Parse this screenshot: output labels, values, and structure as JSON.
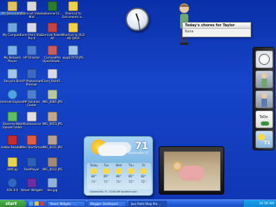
{
  "desktop_icons": [
    {
      "label": "My Documents",
      "color": "#e6c35a"
    },
    {
      "label": "Comcast Video Mail",
      "color": "#d9d9d9"
    },
    {
      "label": "kwbanner12....",
      "color": "#2a7c2a"
    },
    {
      "label": "Shortcut to Documents a...",
      "color": "#f2cf4b"
    },
    {
      "label": "My Computer",
      "color": "#6fa4e0"
    },
    {
      "label": "Corel Paint Shop Pro X",
      "color": "#d8d8e8"
    },
    {
      "label": "Carnival Rewind All",
      "color": "#c94040"
    },
    {
      "label": "Shortcut to OLD HD DATA",
      "color": "#f2cf4b"
    },
    {
      "label": "My Network Places",
      "color": "#7ab0e8"
    },
    {
      "label": "HP Director",
      "color": "#4d7fd0"
    },
    {
      "label": "CarnivalPro OpenShado...",
      "color": "#c95b5b"
    },
    {
      "label": "wppb7978.JPG",
      "color": "#9dc4e8"
    },
    {
      "label": "Recycle Bin",
      "color": "#9fc6e6"
    },
    {
      "label": "HP Photosmart Premier",
      "color": "#3b68c2"
    },
    {
      "label": "Corel_Paint5...",
      "color": "#d8d8e8"
    },
    {
      "label": "Internet Explorer",
      "color": "#4ea3e8"
    },
    {
      "label": "HP Solution Center",
      "color": "#4d7fd0"
    },
    {
      "label": "IMG_0085.JPG",
      "color": "#b7c7a0"
    },
    {
      "label": "Share-to-Web Upload Folder",
      "color": "#5cbf5c"
    },
    {
      "label": "Maintenance",
      "color": "#e0e0e0"
    },
    {
      "label": "IMG_0053.JPG",
      "color": "#c0a888"
    },
    {
      "label": "Adobe Reader 8",
      "color": "#c92a2a"
    },
    {
      "label": "Mom StartSmart",
      "color": "#e35c3c"
    },
    {
      "label": "IMG_0031.JPG",
      "color": "#b8a090"
    },
    {
      "label": "AIMCap",
      "color": "#e6d44a"
    },
    {
      "label": "RealPlayer",
      "color": "#2c5fb8"
    },
    {
      "label": "IMG_0032.JPG",
      "color": "#a08878"
    },
    {
      "label": "AOL 9.0",
      "color": "#2f66c6"
    },
    {
      "label": "Yahoo! Widgets",
      "color": "#6a2fa6"
    },
    {
      "label": "Ilos.jpg",
      "color": "#8fb0d8"
    }
  ],
  "chores_widget": {
    "title": "Today's chores for Taylor",
    "item": "None"
  },
  "sidebar": {
    "todo_label": "ToDo"
  },
  "weather": {
    "temperature": "71",
    "location": "Gainesville, FL",
    "days": [
      {
        "name": "Today",
        "hi": "84°",
        "lo": "71°"
      },
      {
        "name": "Tue",
        "hi": "85°",
        "lo": "71°"
      },
      {
        "name": "Wed",
        "hi": "86°",
        "lo": "72°"
      },
      {
        "name": "Thu",
        "hi": "85°",
        "lo": "72°"
      },
      {
        "name": "Fri",
        "hi": "82°",
        "lo": "72°"
      }
    ],
    "footer": "Gainesville, FL   10:56 AM  weather.com"
  },
  "taskbar": {
    "start_label": "start",
    "tasks": [
      "Yahoo! Widgets - ...",
      "Blogger: Dashboard ...",
      "Jasc Paint Shop Pro ..."
    ],
    "clock": "10:56 AM"
  },
  "colors": {
    "desktop": "#1645c9",
    "taskbar": "#245ed8",
    "start": "#2c8a2c"
  }
}
